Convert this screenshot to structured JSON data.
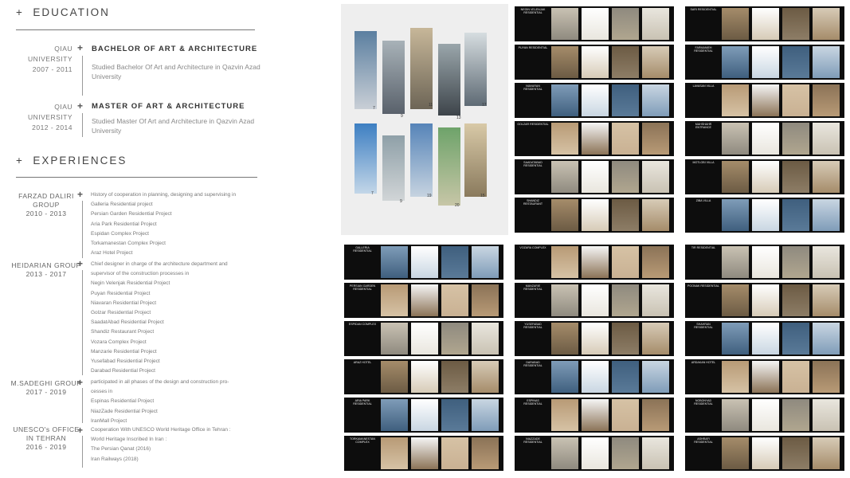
{
  "education": {
    "title": "EDUCATION",
    "items": [
      {
        "years": "2007 - 2011",
        "school": "QIAU UNIVERSITY",
        "degree": "BACHELOR OF ART & ARCHITECTURE",
        "desc": "Studied Bachelor Of  Art and Architecture in Qazvin Azad University"
      },
      {
        "years": "2012 - 2014",
        "school": "QIAU UNIVERSITY",
        "degree": "MASTER OF ART & ARCHITECTURE",
        "desc": "Studied Master Of Art and Architecture in Qazvin Azad University"
      }
    ]
  },
  "experiences": {
    "title": "EXPERIENCES",
    "items": [
      {
        "org": "FARZAD DALIRI GROUP",
        "years": "2010 - 2013",
        "lines": [
          "History of cooperation in planning, designing and supervising in",
          "Galleria Residential project",
          "Persian Garden Residential Project",
          "Aria Park Residential Project",
          "Espidan Complex Project",
          "Torkamanestan Complex Project",
          "Araz Hotel Project"
        ]
      },
      {
        "org": "HEIDARIAN GROUP",
        "years": "2013 - 2017",
        "lines": [
          "Chief designer in charge of the architecture department and",
          "supervisor of the construction processes in",
          "Negin Velenjak Residential Project",
          "Puyan Residential Project",
          "Niavaran Residential Project",
          "Golzar Residential Project",
          "SaadatAbad Residential Project",
          "Shandiz Restaurant Project",
          "Vozara Complex Project",
          "Manzarie Residential Project",
          "Yusefabad Residential Project",
          "Darabad Residential Project"
        ]
      },
      {
        "org": "M.SADEGHI GROUP",
        "years": "2017 - 2019",
        "lines": [
          "participated in all phases of the design and construction pro-",
          "cesses in",
          "Espinas Residential Project",
          "NiazZade Residential Project",
          "IranMall Project"
        ]
      },
      {
        "org": "UNESCO's OFFICE IN TEHRAN",
        "years": "2016 - 2019",
        "lines": [
          "Cooperation With UNESCO World Heritage Office in Tehran :",
          "World Heritage Inscribed In Iran :",
          "The Persian Qanat (2016)",
          "Iran Railways (2018)"
        ]
      }
    ]
  },
  "cover": {
    "numbers_top": [
      "7",
      "9",
      "11",
      "13",
      "17"
    ],
    "numbers_bottom": [
      "7",
      "9",
      "19",
      "20",
      "15"
    ]
  },
  "pages": {
    "top_middle": [
      "NEGIN VELENJAK RESIDENTIAL",
      "PUYAN RESIDENTIAL",
      "NIAVARAN RESIDENTIAL",
      "GOLZAR RESIDENTIAL",
      "SAADATABAD RESIDENTIAL",
      "SHANDIZ RESTAURANT"
    ],
    "top_right": [
      "SARI RESIDENTIAL",
      "FARMANIEH RESIDENTIAL",
      "LAVASAN VILLA",
      "MAHSHAHR ENTRANCE",
      "MOTLOBI VILLA",
      "ZIBA VILLA"
    ],
    "bottom_left": [
      "GALLERIA RESIDENTIAL",
      "PERSIAN GARDEN RESIDENTIAL",
      "ESPIDAN COMPLEX",
      "ARAZ HOTEL",
      "ARIA PARK RESIDENTIAL",
      "TORKAMANESTAN COMPLEX"
    ],
    "bottom_middle": [
      "VOZARA COMPLEX",
      "MANZARIE RESIDENTIAL",
      "YUSEFABAD RESIDENTIAL",
      "DARABAD RESIDENTIAL",
      "ESPINAS RESIDENTIAL",
      "NIAZZADE RESIDENTIAL"
    ],
    "bottom_right": [
      "TIR RESIDENTIAL",
      "POONAK RESIDENTIAL",
      "SHAHRAN RESIDENTIAL",
      "ARDAKAN HOTEL",
      "NOBONYAD RESIDENTIAL",
      "ASHRAFI RESIDENTIAL"
    ]
  }
}
